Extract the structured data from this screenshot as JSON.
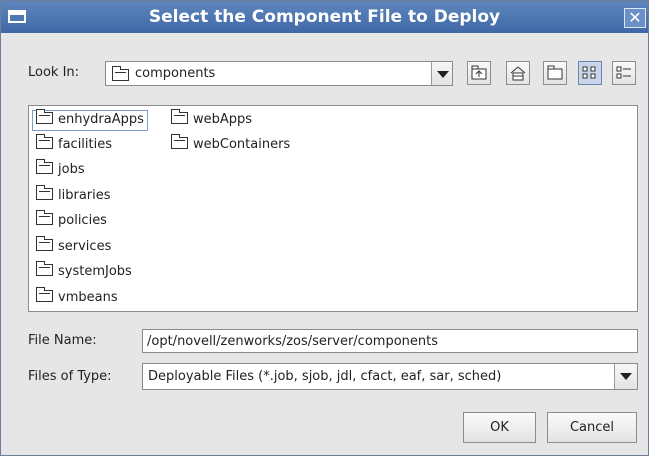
{
  "window": {
    "title": "Select the Component File to Deploy"
  },
  "look_in": {
    "label": "Look In:",
    "value": "components"
  },
  "files": [
    {
      "name": "enhydraApps",
      "selected": true
    },
    {
      "name": "facilities"
    },
    {
      "name": "jobs"
    },
    {
      "name": "libraries"
    },
    {
      "name": "policies"
    },
    {
      "name": "services"
    },
    {
      "name": "systemJobs"
    },
    {
      "name": "vmbeans"
    },
    {
      "name": "webApps"
    },
    {
      "name": "webContainers"
    }
  ],
  "file_name": {
    "label": "File Name:",
    "value": "/opt/novell/zenworks/zos/server/components"
  },
  "file_type": {
    "label": "Files of Type:",
    "value": "Deployable Files (*.job, sjob, jdl, cfact, eaf, sar, sched)"
  },
  "buttons": {
    "ok": "OK",
    "cancel": "Cancel"
  },
  "toolbar_icons": [
    "up-one-level-icon",
    "home-icon",
    "new-folder-icon",
    "list-view-icon",
    "details-view-icon"
  ]
}
